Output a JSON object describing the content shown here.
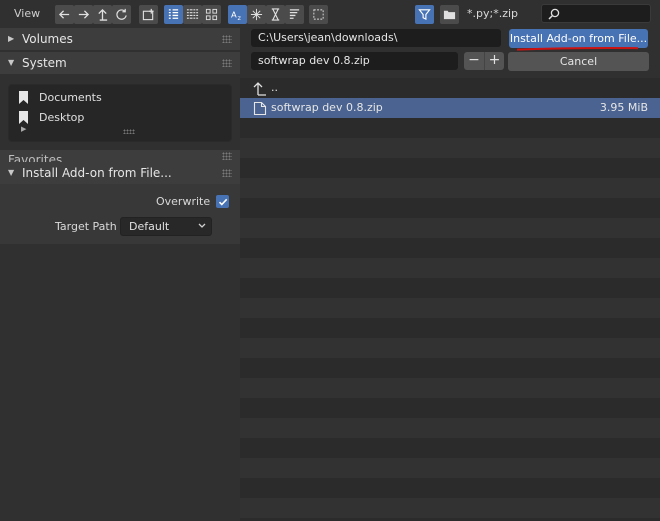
{
  "header": {
    "view_menu": "View",
    "toolbar_icons": [
      "arrow-left-icon",
      "arrow-right-icon",
      "parent-directory-icon",
      "refresh-icon",
      "new-folder-icon",
      "display-vertical-list-icon",
      "display-horizontal-list-icon",
      "display-thumbnails-icon",
      "sort-alpha-icon",
      "sort-extension-icon",
      "sort-time-icon",
      "sort-size-icon",
      "hidden-files-icon",
      "filter-icon",
      "folder-filter-icon"
    ],
    "filter_pattern": "*.py;*.zip",
    "search_placeholder": ""
  },
  "sidebar": {
    "volumes_label": "Volumes",
    "system_label": "System",
    "system_items": [
      {
        "label": "Documents",
        "icon": "bookmark-icon"
      },
      {
        "label": "Desktop",
        "icon": "bookmark-icon"
      }
    ],
    "favorites_label": "Favorites",
    "operator_panel": {
      "title": "Install Add-on from File...",
      "overwrite_label": "Overwrite",
      "overwrite_checked": true,
      "target_path_label": "Target Path",
      "target_path_value": "Default"
    }
  },
  "main": {
    "directory_path": "C:\\Users\\jean\\downloads\\",
    "filename": "softwrap dev 0.8.zip",
    "install_button": "Install Add-on from File...",
    "cancel_button": "Cancel",
    "minus_label": "−",
    "plus_label": "+",
    "files": [
      {
        "name": "..",
        "size": "",
        "icon": "parent-folder-icon",
        "selected": false
      },
      {
        "name": "softwrap dev 0.8.zip",
        "size": "3.95 MiB",
        "icon": "file-icon",
        "selected": true
      }
    ]
  },
  "colors": {
    "accent": "#4772b3",
    "selection": "#4a6390",
    "annotation_underline": "#cc1111"
  }
}
